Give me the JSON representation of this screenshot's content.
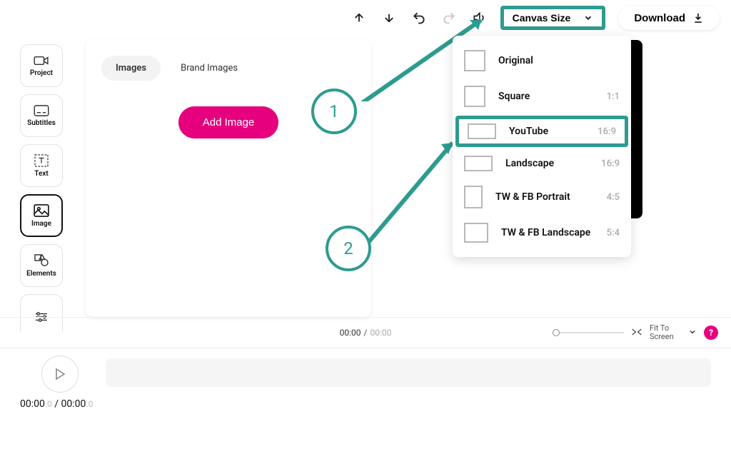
{
  "toolbar": {
    "canvas_size_label": "Canvas Size",
    "download_label": "Download"
  },
  "nav": {
    "project": "Project",
    "subtitles": "Subtitles",
    "text": "Text",
    "image": "Image",
    "elements": "Elements"
  },
  "panel": {
    "tab_images": "Images",
    "tab_brand": "Brand Images",
    "add_image": "Add Image"
  },
  "sizes": [
    {
      "name": "Original",
      "ratio": ""
    },
    {
      "name": "Square",
      "ratio": "1:1"
    },
    {
      "name": "YouTube",
      "ratio": "16:9"
    },
    {
      "name": "Landscape",
      "ratio": "16:9"
    },
    {
      "name": "TW & FB Portrait",
      "ratio": "4:5"
    },
    {
      "name": "TW & FB Landscape",
      "ratio": "5:4"
    }
  ],
  "annotations": {
    "one": "1",
    "two": "2"
  },
  "status": {
    "current": "00:00",
    "sep": "/",
    "total": "00:00",
    "fit": "Fit To Screen",
    "help": "?"
  },
  "timeline": {
    "cur_main": "00:00",
    "cur_dec": ".0",
    "sep": " / ",
    "tot_main": "00:00",
    "tot_dec": ".0"
  }
}
